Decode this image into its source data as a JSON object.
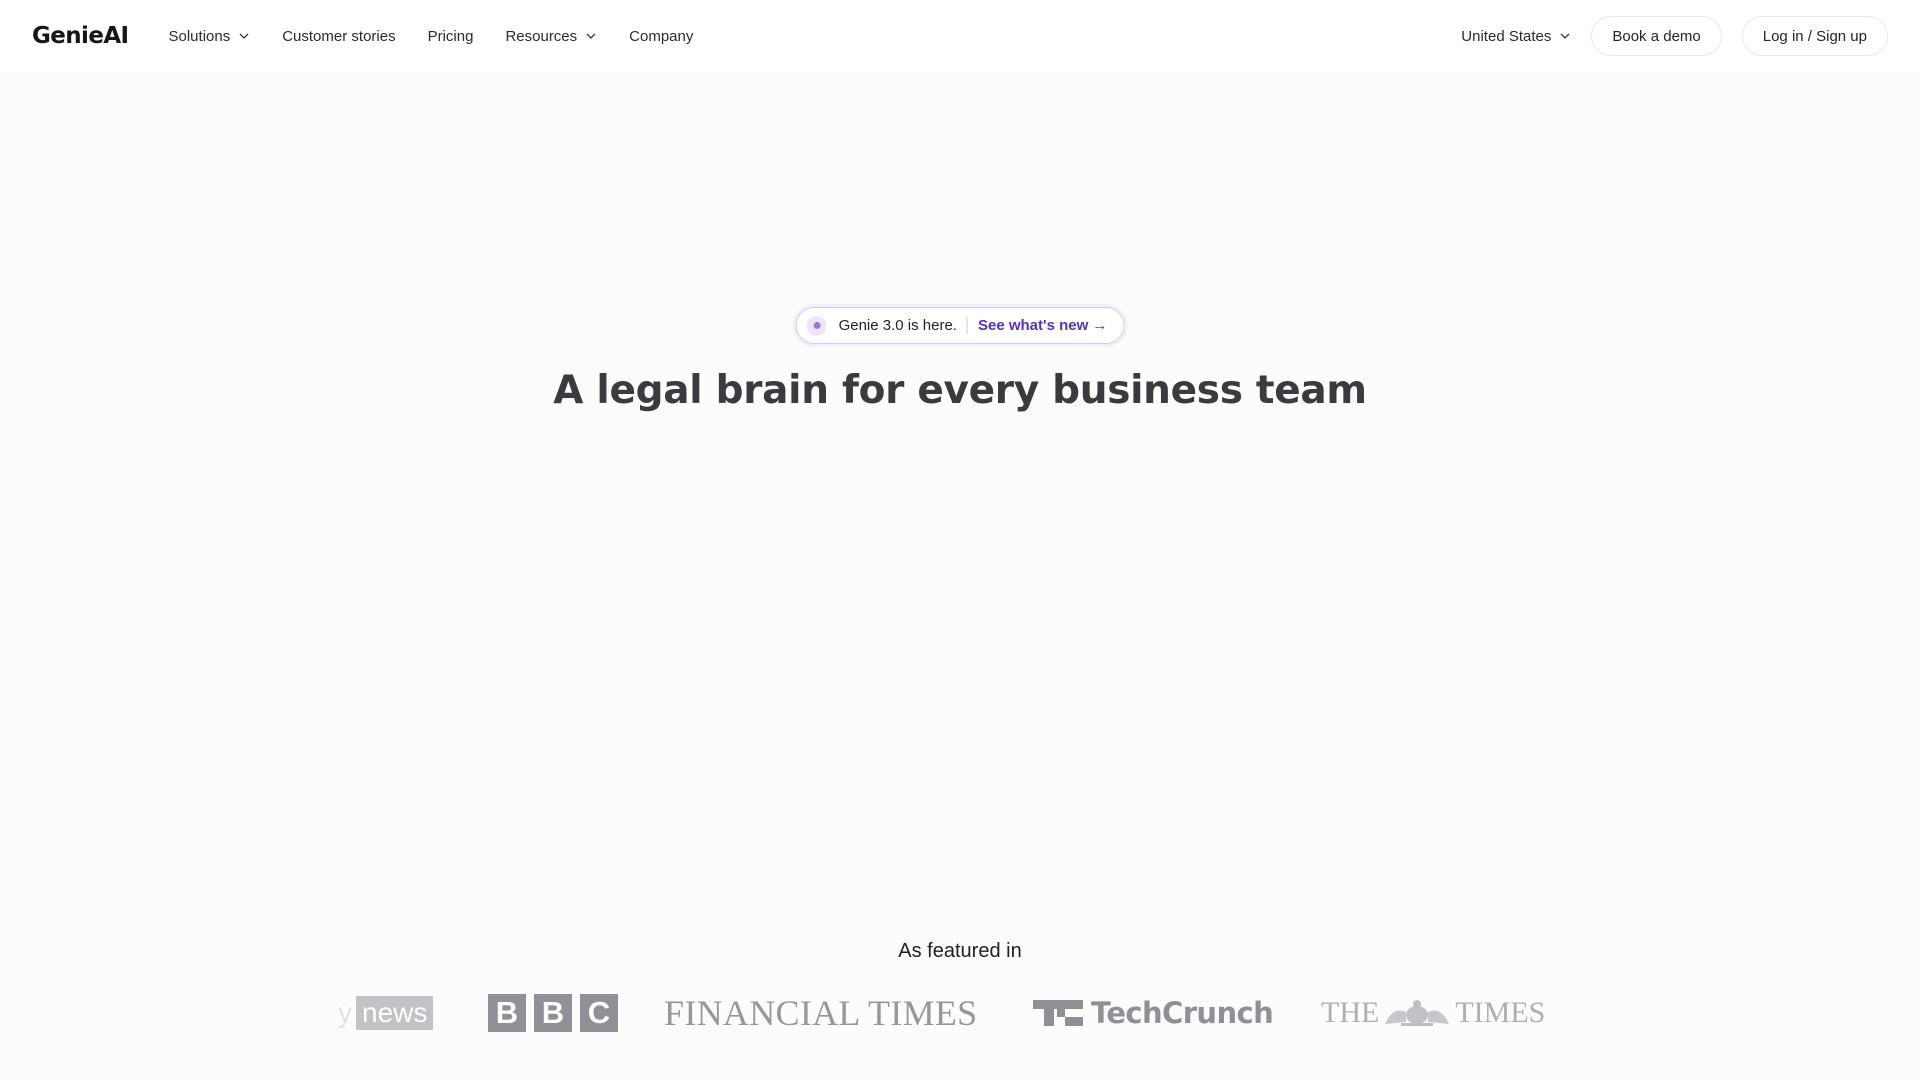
{
  "nav": {
    "logo": "GenieAI",
    "links": [
      {
        "label": "Solutions",
        "has_dropdown": true
      },
      {
        "label": "Customer stories",
        "has_dropdown": false
      },
      {
        "label": "Pricing",
        "has_dropdown": false
      },
      {
        "label": "Resources",
        "has_dropdown": true
      },
      {
        "label": "Company",
        "has_dropdown": false
      }
    ],
    "country": "United States",
    "book_demo": "Book a demo",
    "login": "Log in / Sign up"
  },
  "hero": {
    "announcement": {
      "text": "Genie 3.0 is here.",
      "link": "See what's new →"
    },
    "headline": "A legal brain for every business team"
  },
  "featured": {
    "title": "As featured in",
    "logos": [
      {
        "name": "Sky News",
        "y": "y",
        "news": "news"
      },
      {
        "name": "BBC",
        "letters": [
          "B",
          "B",
          "C"
        ]
      },
      {
        "name": "FINANCIAL TIMES"
      },
      {
        "name": "TechCrunch",
        "word": "TechCrunch"
      },
      {
        "name": "THE TIMES",
        "left": "THE",
        "right": "TIMES"
      }
    ]
  },
  "colors": {
    "accent": "#5b2fc0",
    "accent_border": "#d6c8ef",
    "background": "#fcfcfd",
    "headline": "#3b3b3f"
  },
  "icons": {
    "dropdown": "chevron-down-icon",
    "announcement": "dot-icon"
  }
}
